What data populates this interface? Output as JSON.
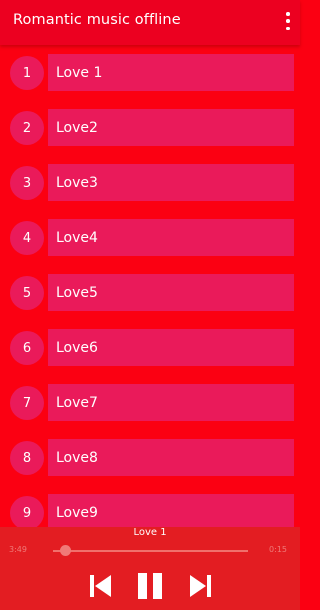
{
  "app": {
    "title": "Romantic music offline"
  },
  "tracks": [
    {
      "number": "1",
      "label": "Love 1"
    },
    {
      "number": "2",
      "label": "Love2"
    },
    {
      "number": "3",
      "label": "Love3"
    },
    {
      "number": "4",
      "label": "Love4"
    },
    {
      "number": "5",
      "label": "Love5"
    },
    {
      "number": "6",
      "label": "Love6"
    },
    {
      "number": "7",
      "label": "Love7"
    },
    {
      "number": "8",
      "label": "Love8"
    },
    {
      "number": "9",
      "label": "Love9"
    }
  ],
  "player": {
    "now_playing": "Love 1",
    "elapsed": "3:49",
    "total": "0:15",
    "progress": 0.04,
    "controls": [
      "previous-icon",
      "pause-icon",
      "next-icon"
    ]
  },
  "colors": {
    "background": "#fb0012",
    "appbar": "#ec0020",
    "item": "#ea1a5a",
    "player": "#e31d22"
  }
}
